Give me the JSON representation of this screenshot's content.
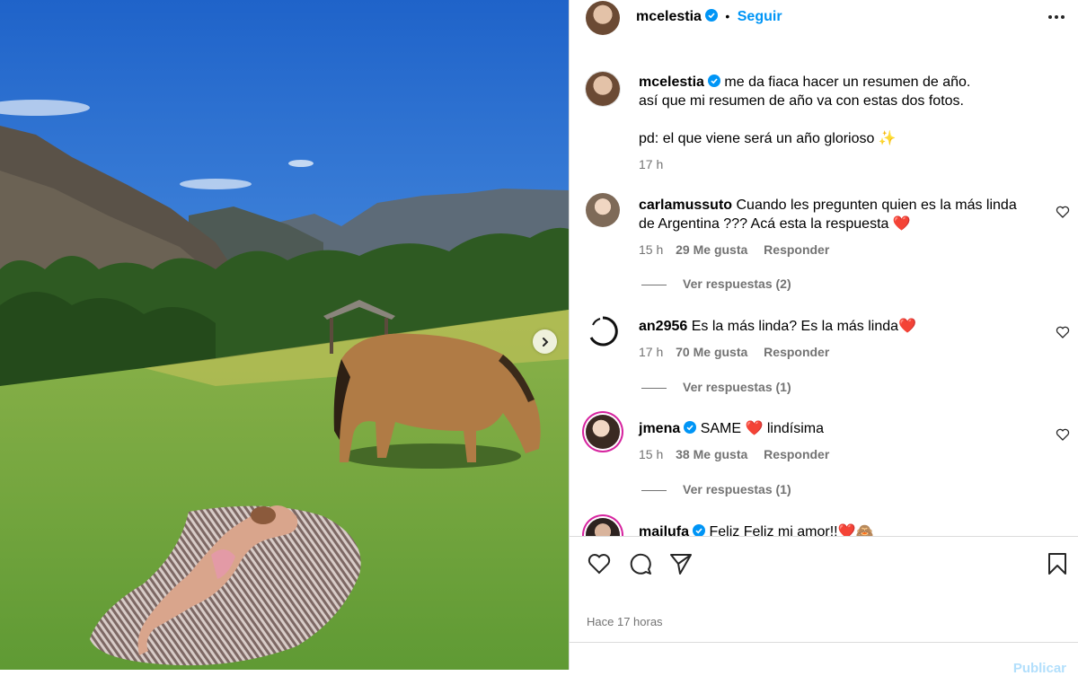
{
  "post": {
    "author": "mcelestia",
    "follow_label": "Seguir",
    "dot": "•",
    "caption": {
      "line1": "me da fiaca hacer un resumen de año.",
      "line2": "así que mi resumen de año va con estas dos fotos.",
      "line3": "pd: el que viene será un año glorioso ✨",
      "time": "17 h"
    }
  },
  "comments": [
    {
      "user": "carlamussuto",
      "text": "Cuando les pregunten quien es la más linda de Argentina ??? Acá esta la respuesta ❤️",
      "time": "15 h",
      "likes": "29 Me gusta",
      "reply_label": "Responder",
      "replies_label": "Ver respuestas (2)"
    },
    {
      "user": "an2956",
      "text": "Es la más linda? Es la más linda❤️",
      "time": "17 h",
      "likes": "70 Me gusta",
      "reply_label": "Responder",
      "replies_label": "Ver respuestas (1)"
    },
    {
      "user": "jmena",
      "text": "SAME ❤️ lindísima",
      "time": "15 h",
      "likes": "38 Me gusta",
      "reply_label": "Responder",
      "replies_label": "Ver respuestas (1)"
    },
    {
      "user": "mailufa",
      "text": "Feliz Feliz mi amor!!❤️🙈"
    }
  ],
  "footer": {
    "time_ago": "Hace 17 horas",
    "publish_label": "Publicar",
    "comment_placeholder": ""
  },
  "icons": {
    "verified": "verified-badge-icon",
    "more": "more-options-icon",
    "like": "heart-icon",
    "comment": "comment-icon",
    "share": "share-icon",
    "save": "bookmark-icon",
    "next": "chevron-right-icon"
  },
  "colors": {
    "accent": "#0095f6",
    "muted": "#737373",
    "border": "#dbdbdb",
    "verified": "#0095f6",
    "heart": "#e0245e"
  }
}
